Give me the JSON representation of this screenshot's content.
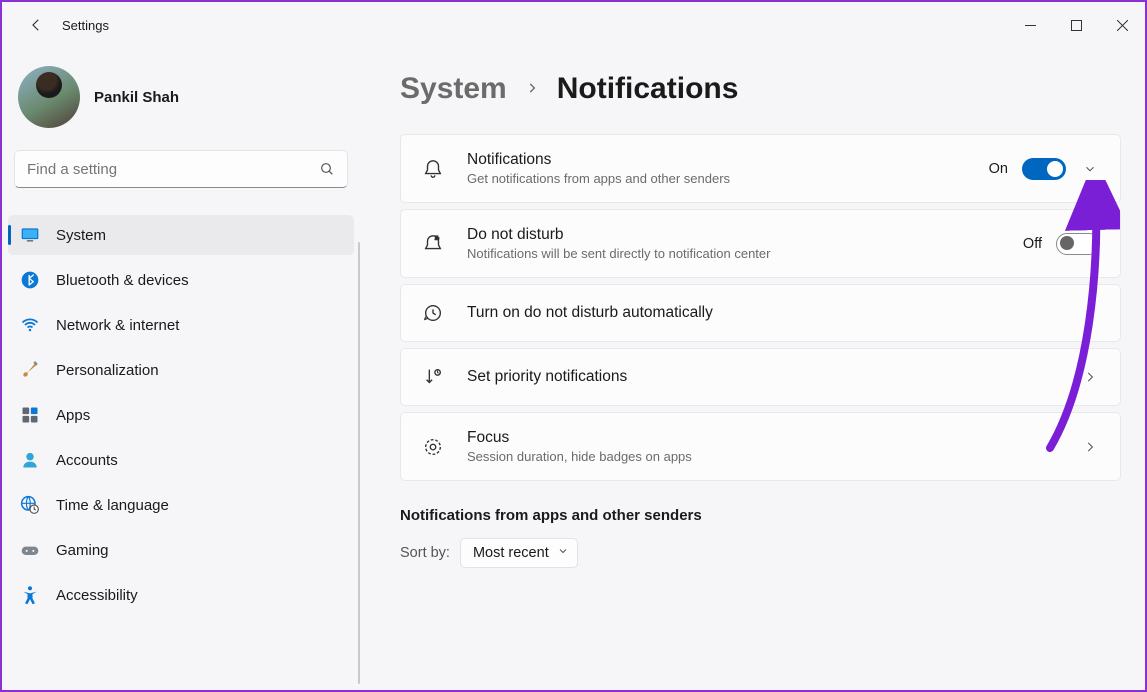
{
  "titlebar": {
    "title": "Settings"
  },
  "profile": {
    "name": "Pankil Shah"
  },
  "search": {
    "placeholder": "Find a setting"
  },
  "sidebar": {
    "items": [
      {
        "label": "System",
        "icon": "monitor",
        "active": true
      },
      {
        "label": "Bluetooth & devices",
        "icon": "bluetooth"
      },
      {
        "label": "Network & internet",
        "icon": "wifi"
      },
      {
        "label": "Personalization",
        "icon": "brush"
      },
      {
        "label": "Apps",
        "icon": "apps"
      },
      {
        "label": "Accounts",
        "icon": "person"
      },
      {
        "label": "Time & language",
        "icon": "globe-clock"
      },
      {
        "label": "Gaming",
        "icon": "gamepad"
      },
      {
        "label": "Accessibility",
        "icon": "accessibility"
      }
    ]
  },
  "breadcrumb": {
    "parent": "System",
    "current": "Notifications"
  },
  "cards": {
    "notifications": {
      "title": "Notifications",
      "sub": "Get notifications from apps and other senders",
      "state_label": "On",
      "on": true
    },
    "dnd": {
      "title": "Do not disturb",
      "sub": "Notifications will be sent directly to notification center",
      "state_label": "Off",
      "on": false
    },
    "auto_dnd": {
      "title": "Turn on do not disturb automatically"
    },
    "priority": {
      "title": "Set priority notifications"
    },
    "focus": {
      "title": "Focus",
      "sub": "Session duration, hide badges on apps"
    }
  },
  "apps_section": {
    "title": "Notifications from apps and other senders",
    "sort_label": "Sort by:",
    "sort_value": "Most recent"
  }
}
